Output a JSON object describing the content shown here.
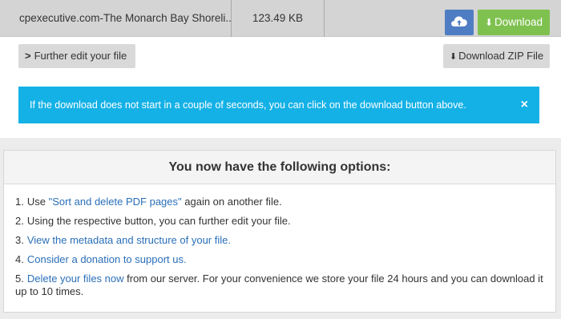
{
  "file": {
    "name": "cpexecutive.com-The Monarch Bay Shoreli...",
    "size": "123.49 KB"
  },
  "buttons": {
    "download_label": "Download",
    "further_edit_label": "Further edit your file",
    "download_zip_label": "Download ZIP File"
  },
  "alert": {
    "text": "If the download does not start in a couple of seconds, you can click on the download button above.",
    "close": "×"
  },
  "options": {
    "title": "You now have the following options:",
    "items": [
      {
        "num": "1.",
        "pre": "Use ",
        "link": "\"Sort and delete PDF pages\"",
        "post": " again on another file."
      },
      {
        "num": "2.",
        "pre": "Using the respective button, you can further edit your file.",
        "link": "",
        "post": ""
      },
      {
        "num": "3.",
        "pre": "",
        "link": "View the metadata and structure of your file.",
        "post": ""
      },
      {
        "num": "4.",
        "pre": "",
        "link": "Consider a donation to support us.",
        "post": ""
      },
      {
        "num": "5.",
        "pre": "",
        "link": "Delete your files now",
        "post": " from our server. For your convenience we store your file 24 hours and you can download it up to 10 times."
      }
    ]
  },
  "icons": {
    "cloud": "cloud-upload-icon",
    "download": "download-icon",
    "chevron": "chevron-right-icon",
    "close": "close-icon"
  },
  "colors": {
    "cloud_button": "#4f7dc3",
    "download_button": "#7fc14f",
    "alert_background": "#14b1e6",
    "link": "#2a6fb8"
  }
}
